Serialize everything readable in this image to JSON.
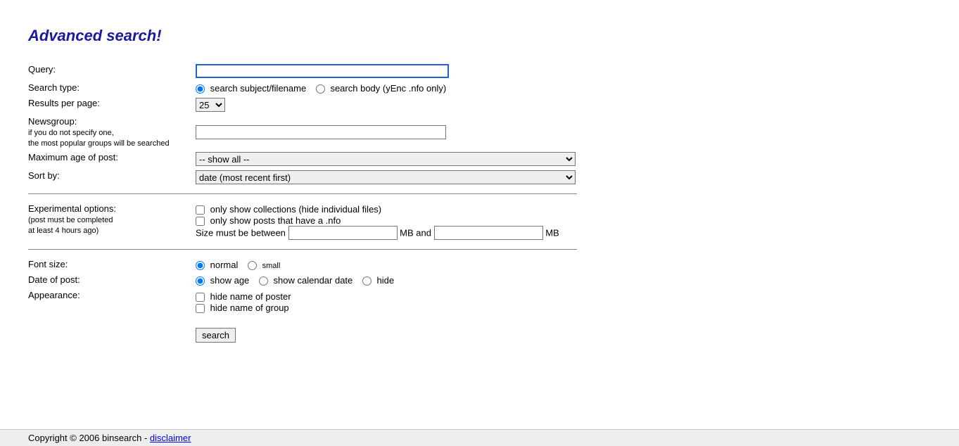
{
  "title": "Advanced search!",
  "labels": {
    "query": "Query:",
    "search_type": "Search type:",
    "results_per_page": "Results per page:",
    "newsgroup": "Newsgroup:",
    "newsgroup_sub1": "if you do not specify one,",
    "newsgroup_sub2": "the most popular groups will be searched",
    "max_age": "Maximum age of post:",
    "sort_by": "Sort by:",
    "experimental": "Experimental options:",
    "experimental_sub1": "(post must be completed",
    "experimental_sub2": "at least 4 hours ago)",
    "font_size": "Font size:",
    "date_of_post": "Date of post:",
    "appearance": "Appearance:"
  },
  "search_type": {
    "subject": "search subject/filename",
    "body": "search body (yEnc .nfo only)"
  },
  "results_per_page_value": "25",
  "max_age_value": "-- show all --",
  "sort_by_value": "date (most recent first)",
  "experimental": {
    "collections": "only show collections (hide individual files)",
    "nfo": "only show posts that have a .nfo",
    "size_prefix": "Size must be between",
    "size_mid": "MB and",
    "size_suffix": "MB"
  },
  "font_size": {
    "normal": "normal",
    "small": "small"
  },
  "date_of_post": {
    "show_age": "show age",
    "show_calendar": "show calendar date",
    "hide": "hide"
  },
  "appearance": {
    "hide_poster": "hide name of poster",
    "hide_group": "hide name of group"
  },
  "search_button": "search",
  "footer": {
    "copyright": "Copyright © 2006 binsearch - ",
    "disclaimer": "disclaimer"
  }
}
